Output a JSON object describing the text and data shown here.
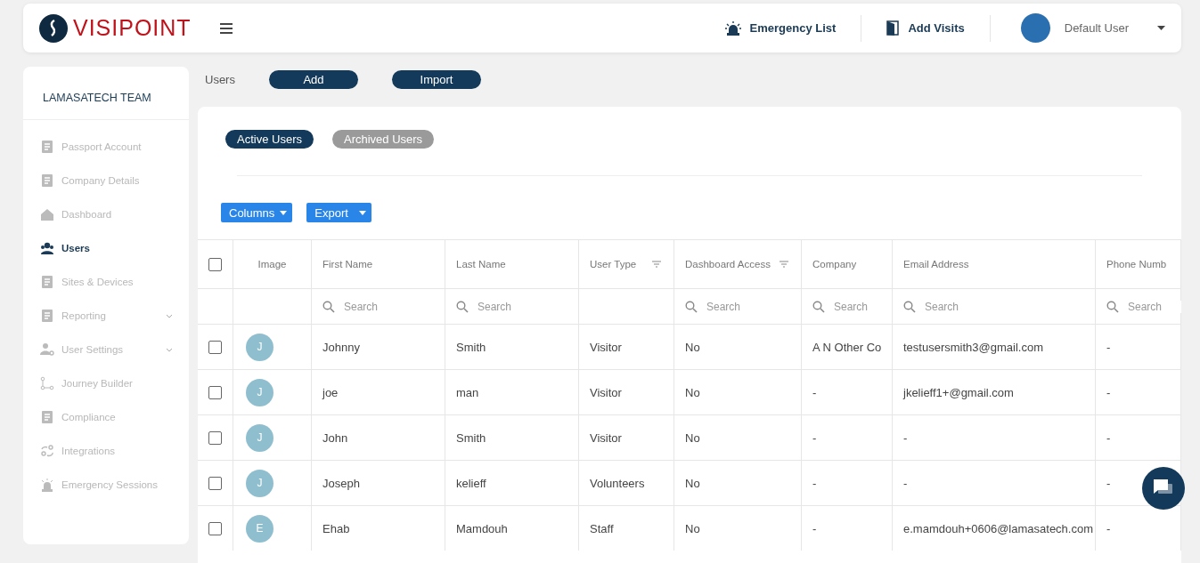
{
  "header": {
    "logo": "VISIPOINT",
    "links": [
      {
        "label": "Emergency List",
        "kind": "siren"
      },
      {
        "label": "Add Visits",
        "kind": "door"
      }
    ],
    "user": {
      "name": "Default User"
    }
  },
  "sidebar": {
    "team": "LAMASATECH TEAM",
    "items": [
      {
        "label": "Passport Account",
        "selected": false,
        "kind": "link"
      },
      {
        "label": "Company Details",
        "selected": false,
        "kind": "link"
      },
      {
        "label": "Dashboard",
        "selected": false,
        "kind": "link"
      },
      {
        "label": "Users",
        "selected": true,
        "kind": "link"
      },
      {
        "label": "Sites & Devices",
        "selected": false,
        "kind": "link"
      },
      {
        "label": "Reporting",
        "selected": false,
        "kind": "group"
      },
      {
        "label": "User Settings",
        "selected": false,
        "kind": "group"
      },
      {
        "label": "Journey Builder",
        "selected": false,
        "kind": "link"
      },
      {
        "label": "Compliance",
        "selected": false,
        "kind": "link"
      },
      {
        "label": "Integrations",
        "selected": false,
        "kind": "link"
      },
      {
        "label": "Emergency Sessions",
        "selected": false,
        "kind": "link"
      }
    ]
  },
  "page": {
    "title": "Users",
    "actions": [
      "Add",
      "Import"
    ]
  },
  "tabs": [
    {
      "label": "Active Users",
      "selected": true
    },
    {
      "label": "Archived Users",
      "selected": false
    }
  ],
  "toolbar": [
    "Columns",
    "Export"
  ],
  "table": {
    "select_all": {
      "checked": false
    },
    "columns": [
      {
        "label": "Image"
      },
      {
        "label": "First Name",
        "placeholder": "Search"
      },
      {
        "label": "Last Name",
        "placeholder": "Search"
      },
      {
        "label": "User Type",
        "filter": true
      },
      {
        "label": "Dashboard Access",
        "filter": true,
        "placeholder": "Search"
      },
      {
        "label": "Company",
        "placeholder": "Search"
      },
      {
        "label": "Email Address",
        "placeholder": "Search"
      },
      {
        "label": "Phone Numb",
        "placeholder": "Search"
      }
    ],
    "rows": [
      {
        "checked": false,
        "cells": [
          "J",
          "Johnny",
          "Smith",
          "Visitor",
          "No",
          "A N Other Co",
          "testusersmith3@gmail.com",
          "-"
        ]
      },
      {
        "checked": false,
        "cells": [
          "J",
          "joe",
          "man",
          "Visitor",
          "No",
          "-",
          "jkelieff1+@gmail.com",
          "-"
        ]
      },
      {
        "checked": false,
        "cells": [
          "J",
          "John",
          "Smith",
          "Visitor",
          "No",
          "-",
          "-",
          "-"
        ]
      },
      {
        "checked": false,
        "cells": [
          "J",
          "Joseph",
          "kelieff",
          "Volunteers",
          "No",
          "-",
          "-",
          "-"
        ]
      },
      {
        "checked": false,
        "cells": [
          "E",
          "Ehab",
          "Mamdouh",
          "Staff",
          "No",
          "-",
          "e.mamdouh+0606@lamasatech.com",
          "-"
        ]
      }
    ]
  }
}
